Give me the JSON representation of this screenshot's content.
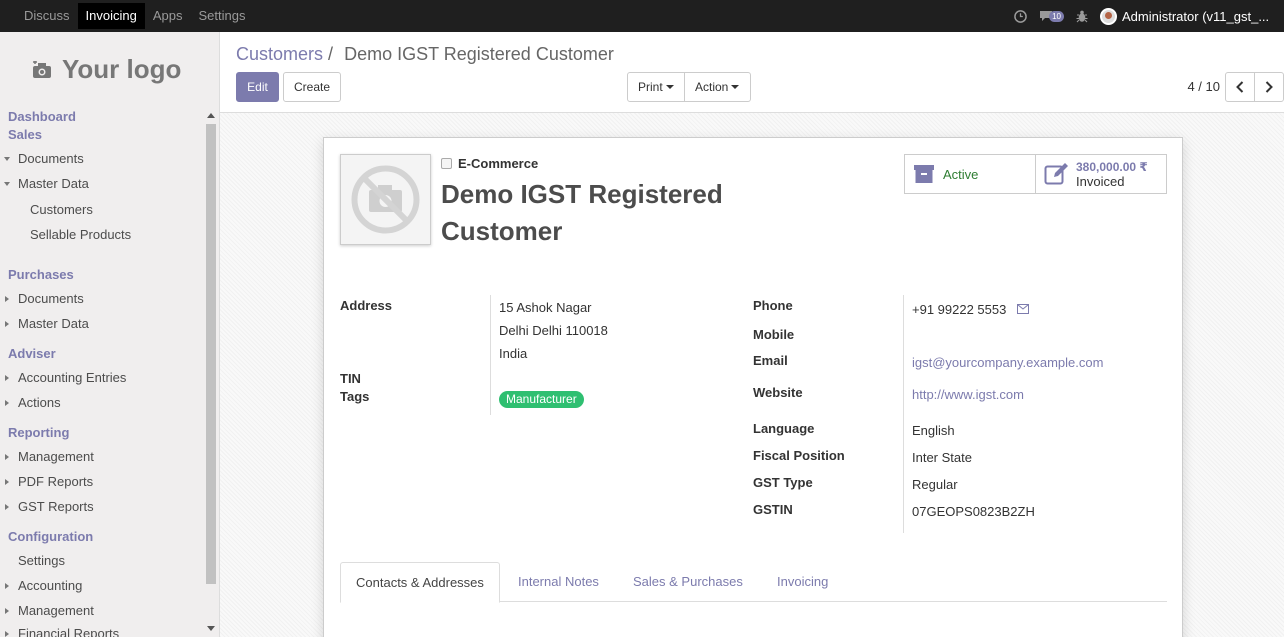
{
  "topbar": {
    "menu": [
      "Discuss",
      "Invoicing",
      "Apps",
      "Settings"
    ],
    "active_menu": "Invoicing",
    "message_count": "10",
    "user": "Administrator (v11_gst_..."
  },
  "sidebar": {
    "logo_text": "Your logo",
    "dashboard": "Dashboard",
    "sales": "Sales",
    "sales_items": [
      "Documents",
      "Master Data"
    ],
    "master_data_items": [
      "Customers",
      "Sellable Products"
    ],
    "purchases": "Purchases",
    "purchases_items": [
      "Documents",
      "Master Data"
    ],
    "adviser": "Adviser",
    "adviser_items": [
      "Accounting Entries",
      "Actions"
    ],
    "reporting": "Reporting",
    "reporting_items": [
      "Management",
      "PDF Reports",
      "GST Reports"
    ],
    "configuration": "Configuration",
    "configuration_items": [
      "Settings",
      "Accounting",
      "Management",
      "Financial Reports"
    ]
  },
  "control_panel": {
    "breadcrumb_parent": "Customers",
    "breadcrumb_sep": "/",
    "breadcrumb_current": "Demo IGST Registered Customer",
    "edit_label": "Edit",
    "create_label": "Create",
    "print_label": "Print",
    "action_label": "Action",
    "pager": "4 / 10"
  },
  "form": {
    "ecommerce_label": "E-Commerce",
    "ecommerce_checked": false,
    "name": "Demo IGST Registered Customer",
    "status_active": "Active",
    "invoiced_amount": "380,000.00 ₹",
    "invoiced_label": "Invoiced",
    "labels": {
      "address": "Address",
      "tin": "TIN",
      "tags": "Tags",
      "phone": "Phone",
      "mobile": "Mobile",
      "email": "Email",
      "website": "Website",
      "language": "Language",
      "fiscal_position": "Fiscal Position",
      "gst_type": "GST Type",
      "gstin": "GSTIN"
    },
    "address_line1": "15 Ashok Nagar",
    "address_line2": "Delhi Delhi 110018",
    "address_country": "India",
    "tag": "Manufacturer",
    "phone": "+91 99222 5553",
    "email": "igst@yourcompany.example.com",
    "website": "http://www.igst.com",
    "language": "English",
    "fiscal_position": "Inter State",
    "gst_type": "Regular",
    "gstin": "07GEOPS0823B2ZH"
  },
  "tabs": [
    "Contacts & Addresses",
    "Internal Notes",
    "Sales & Purchases",
    "Invoicing"
  ],
  "colors": {
    "brand": "#7c7bad",
    "tag_green": "#2fbf71",
    "topbar": "#1f1f1f",
    "active_green": "#2e7d32"
  }
}
